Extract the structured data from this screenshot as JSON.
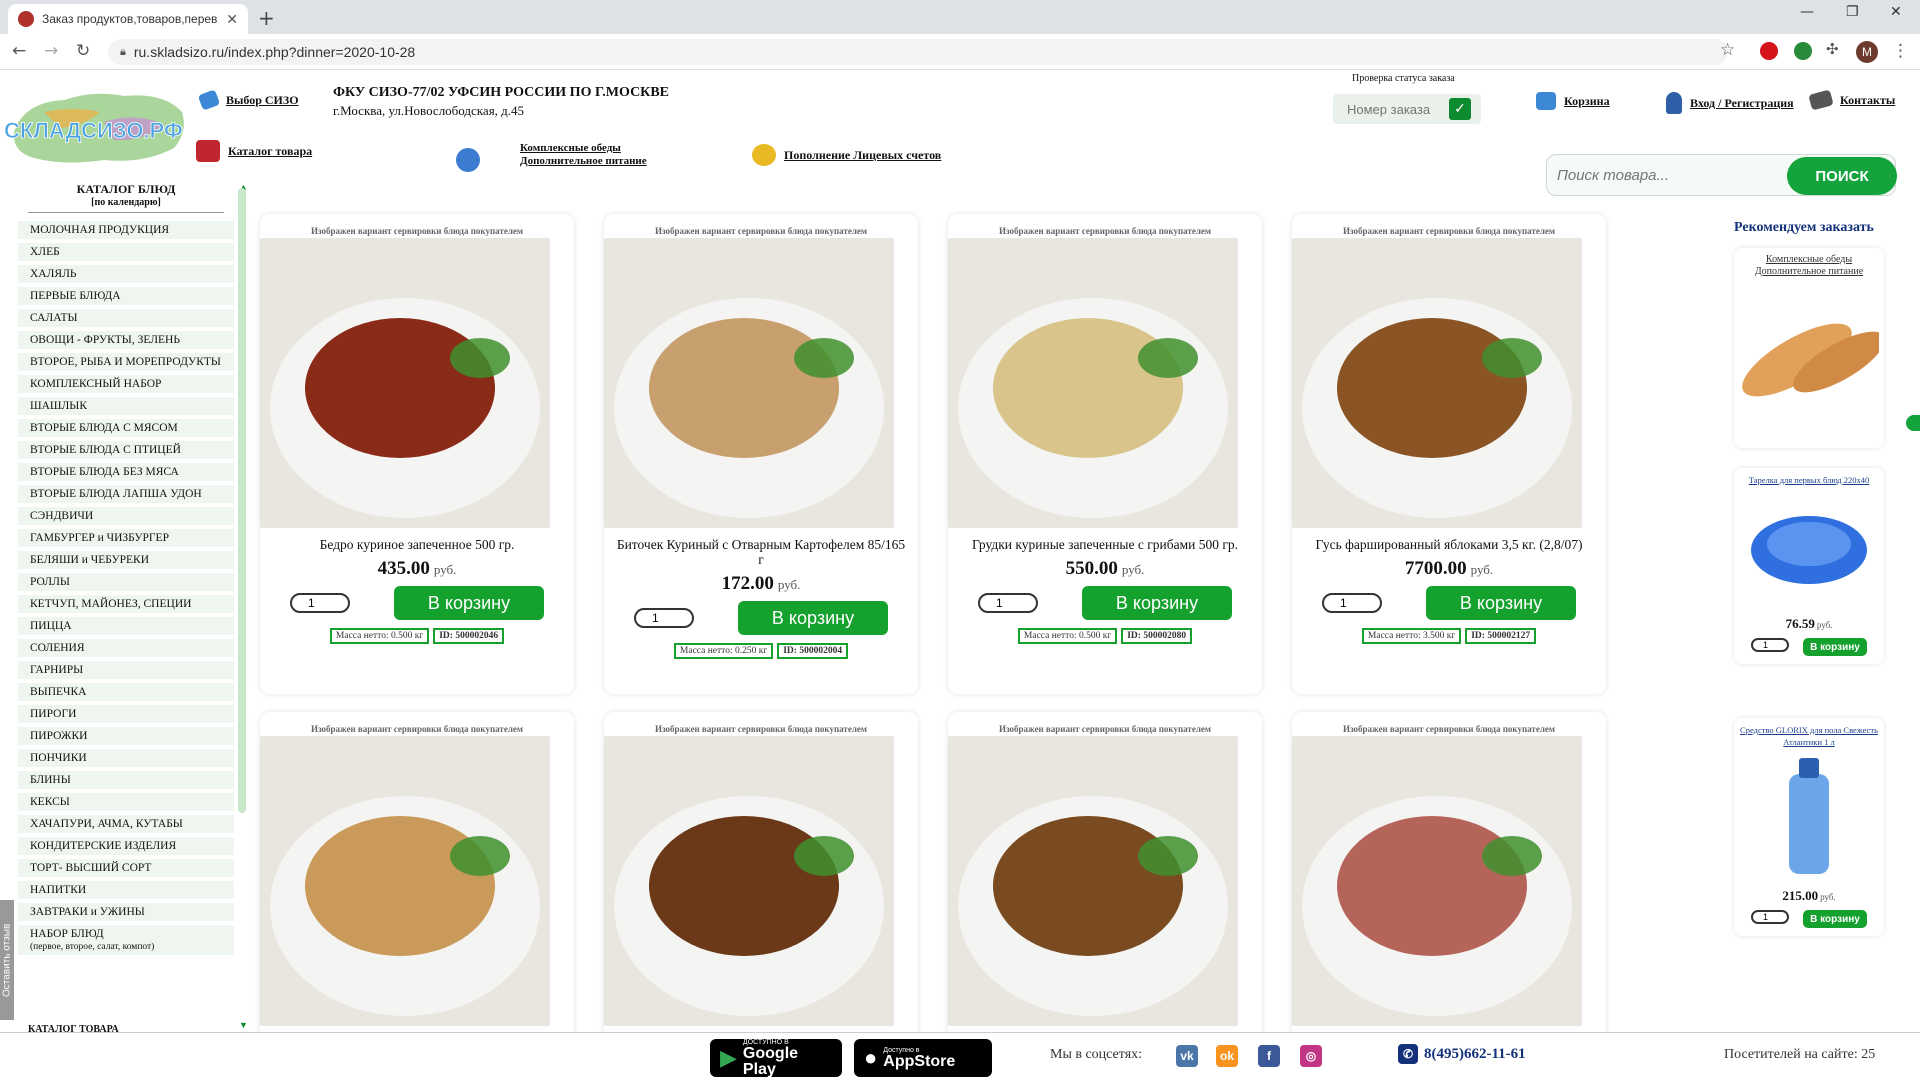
{
  "browser": {
    "tab_title": "Заказ продуктов,товаров,перев",
    "url": "ru.skladsizo.ru/index.php?dinner=2020-10-28",
    "profile_initial": "M"
  },
  "header": {
    "logo_text": "СКЛАДСИЗО.РФ",
    "select_sizo": "Выбор СИЗО",
    "catalog_link": "Каталог товара",
    "org_title": "ФКУ СИЗО-77/02 УФСИН РОССИИ ПО Г.МОСКВЕ",
    "org_address": "г.Москва, ул.Новослободская, д.45",
    "complex_meals": "Комплексные обеды",
    "extra_food": "Дополнительное питание",
    "topup": "Пополнение Лицевых счетов",
    "status_label": "Проверка статуса заказа",
    "status_placeholder": "Номер заказа",
    "cart": "Корзина",
    "login": "Вход / Регистрация",
    "contacts": "Контакты",
    "search_placeholder": "Поиск товара...",
    "search_button": "ПОИСК"
  },
  "sidebar": {
    "title": "КАТАЛОГ БЛЮД",
    "subtitle": "[по календарю]",
    "items": [
      "МОЛОЧНАЯ ПРОДУКЦИЯ",
      "ХЛЕБ",
      "ХАЛЯЛЬ",
      "ПЕРВЫЕ БЛЮДА",
      "САЛАТЫ",
      "ОВОЩИ - ФРУКТЫ, ЗЕЛЕНЬ",
      "ВТОРОЕ, РЫБА И МОРЕПРОДУКТЫ",
      "КОМПЛЕКСНЫЙ НАБОР",
      "ШАШЛЫК",
      "ВТОРЫЕ БЛЮДА С МЯСОМ",
      "ВТОРЫЕ БЛЮДА С ПТИЦЕЙ",
      "ВТОРЫЕ БЛЮДА БЕЗ МЯСА",
      "ВТОРЫЕ БЛЮДА ЛАПША УДОН",
      "СЭНДВИЧИ",
      "ГАМБУРГЕР и ЧИЗБУРГЕР",
      "БЕЛЯШИ и ЧЕБУРЕКИ",
      "РОЛЛЫ",
      "КЕТЧУП, МАЙОНЕЗ, СПЕЦИИ",
      "ПИЦЦА",
      "СОЛЕНИЯ",
      "ГАРНИРЫ",
      "ВЫПЕЧКА",
      "ПИРОГИ",
      "ПИРОЖКИ",
      "ПОНЧИКИ",
      "БЛИНЫ",
      "КЕКСЫ",
      "ХАЧАПУРИ, АЧМА, КУТАБЫ",
      "КОНДИТЕРСКИЕ ИЗДЕЛИЯ",
      "ТОРТ- ВЫСШИЙ СОРТ",
      "НАПИТКИ",
      "ЗАВТРАКИ и УЖИНЫ"
    ],
    "last_item": "НАБОР БЛЮД",
    "last_item_note": "(первое, второе, салат, компот)",
    "catalog_footer": "КАТАЛОГ ТОВАРА",
    "feedback": "Оставить отзыв"
  },
  "products_common": {
    "serving_note": "Изображен вариант сервировки блюда покупателем",
    "currency": "руб.",
    "cart_button": "В корзину",
    "qty_default": "1"
  },
  "products": [
    {
      "name": "Бедро куриное запеченное 500 гр.",
      "price": "435.00",
      "mass": "Масса нетто: 0.500 кг",
      "id": "ID: 500002046",
      "color": "#8a2b17"
    },
    {
      "name": "Биточек Куриный с Отварным Картофелем 85/165 г",
      "price": "172.00",
      "mass": "Масса нетто: 0.250 кг",
      "id": "ID: 500002004",
      "color": "#c8a070"
    },
    {
      "name": "Грудки куриные запеченные с грибами 500 гр.",
      "price": "550.00",
      "mass": "Масса нетто: 0.500 кг",
      "id": "ID: 500002080",
      "color": "#d9c58c"
    },
    {
      "name": "Гусь фаршированный яблоками 3,5 кг. (2,8/07)",
      "price": "7700.00",
      "mass": "Масса нетто: 3.500 кг",
      "id": "ID: 500002127",
      "color": "#8a5424"
    },
    {
      "name": "",
      "color": "#c99a5a"
    },
    {
      "name": "",
      "color": "#6b3818"
    },
    {
      "name": "",
      "color": "#7a4a20"
    },
    {
      "name": "",
      "color": "#b5645a"
    }
  ],
  "recommend": {
    "title": "Рекомендуем заказать",
    "banner_line1": "Комплексные обеды",
    "banner_line2": "Дополнительное питание",
    "items": [
      {
        "name": "Тарелка для первых блюд 220х40",
        "price": "76.59",
        "color": "#2f6fe0"
      },
      {
        "name": "Средство GLORIX для пола Свежесть Атлантики 1 л",
        "price": "215.00",
        "color": "#6aa6e8"
      }
    ],
    "buy_button": "В корзину",
    "currency": "руб.",
    "qty_default": "1"
  },
  "footer": {
    "gp_small": "ДОСТУПНО В",
    "gp_big": "Google Play",
    "as_small": "Доступно в",
    "as_big": "AppStore",
    "social_label": "Мы в соцсетях:",
    "phone": "8(495)662-11-61",
    "visitors": "Посетителей на сайте: 25"
  },
  "colors": {
    "accent_green": "#15a12e",
    "title_blue": "#13327a"
  }
}
